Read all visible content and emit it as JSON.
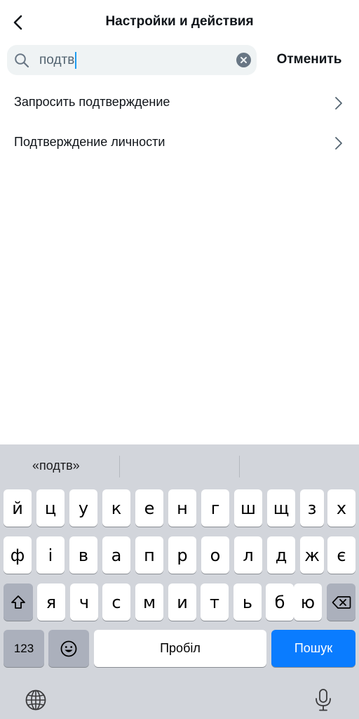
{
  "header": {
    "title": "Настройки и действия",
    "back_icon": "chevron-left-icon"
  },
  "search": {
    "query": "подтв",
    "cancel_label": "Отменить",
    "accent_color": "#1d9bf0"
  },
  "results": [
    {
      "label": "Запросить подтверждение"
    },
    {
      "label": "Подтверждение личности"
    }
  ],
  "keyboard": {
    "suggestions": [
      "«подтв»",
      "",
      ""
    ],
    "rows": [
      [
        "й",
        "ц",
        "у",
        "к",
        "е",
        "н",
        "г",
        "ш",
        "щ",
        "з",
        "х"
      ],
      [
        "ф",
        "і",
        "в",
        "а",
        "п",
        "р",
        "о",
        "л",
        "д",
        "ж",
        "є"
      ],
      [
        "я",
        "ч",
        "с",
        "м",
        "и",
        "т",
        "ь",
        "б",
        "ю"
      ]
    ],
    "numbers_label": "123",
    "space_label": "Пробіл",
    "search_label": "Пошук",
    "search_key_color": "#0a7cff"
  }
}
